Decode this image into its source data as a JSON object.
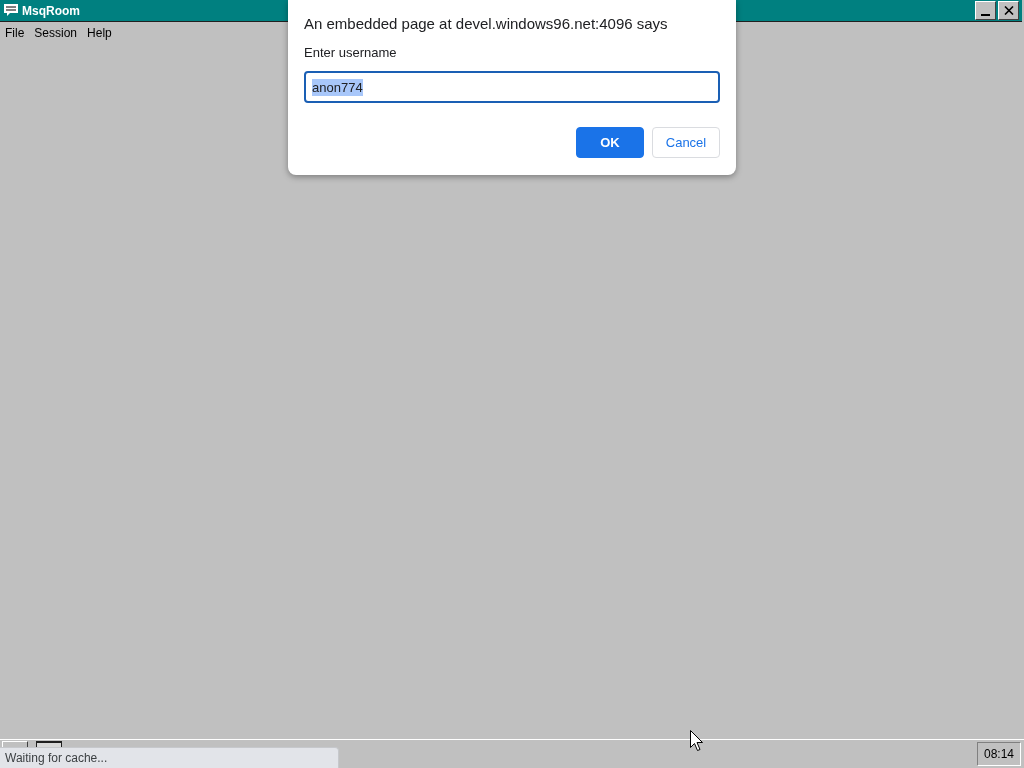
{
  "window": {
    "title": "MsqRoom"
  },
  "menu": [
    {
      "label": "File"
    },
    {
      "label": "Session"
    },
    {
      "label": "Help"
    }
  ],
  "dialog": {
    "title": "An embedded page at devel.windows96.net:4096 says",
    "prompt": "Enter username",
    "input": {
      "value": "anon774",
      "text_selected": true
    },
    "buttons": [
      {
        "label": "OK",
        "kind": "primary"
      },
      {
        "label": "Cancel",
        "kind": "secondary"
      }
    ]
  },
  "taskbar": {
    "clock": "08:14"
  },
  "status_bubble": "Waiting for cache..."
}
